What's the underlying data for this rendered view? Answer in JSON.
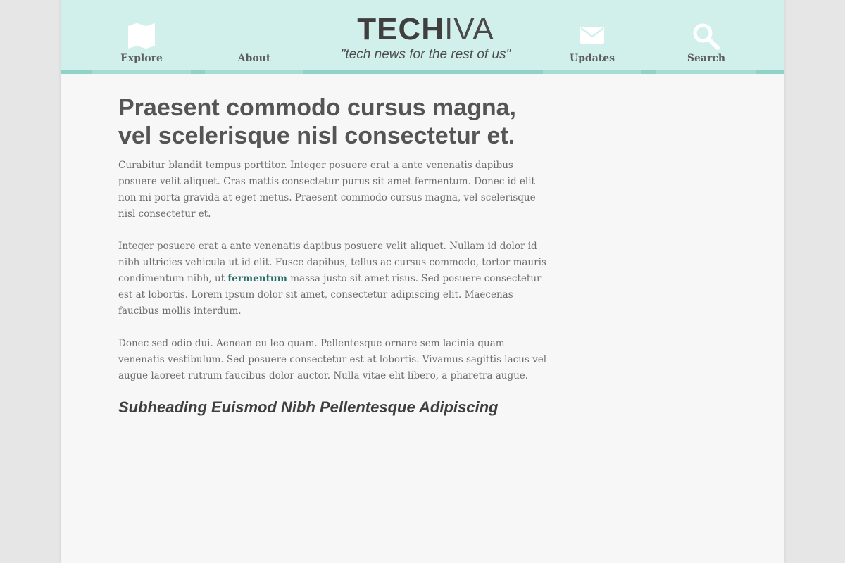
{
  "logo": {
    "tech": "TECH",
    "iva": "IVA",
    "tagline": "\"tech news for the rest of us\""
  },
  "nav": {
    "explore": "Explore",
    "about": "About",
    "updates": "Updates",
    "search": "Search"
  },
  "article": {
    "title": "Praesent commodo cursus magna, vel scelerisque nisl consectetur et.",
    "p1": "Curabitur blandit tempus porttitor. Integer posuere erat a ante venenatis dapibus posuere velit aliquet. Cras mattis consectetur purus sit amet fermentum. Donec id elit non mi porta gravida at eget metus. Praesent commodo cursus magna, vel scelerisque nisl consectetur et.",
    "p2_before": "Integer posuere erat a ante venenatis dapibus posuere velit aliquet. Nullam id dolor id nibh ultricies vehicula ut id elit. Fusce dapibus, tellus ac cursus commodo, tortor mauris condimentum nibh, ut ",
    "p2_link": "fermentum",
    "p2_after": " massa justo sit amet risus. Sed posuere consectetur est at lobortis. Lorem ipsum dolor sit amet, consectetur adipiscing elit. Maecenas faucibus mollis interdum.",
    "p3": "Donec sed odio dui. Aenean eu leo quam. Pellentesque ornare sem lacinia quam venenatis vestibulum. Sed posuere consectetur est at lobortis. Vivamus sagittis lacus vel augue laoreet rutrum faucibus dolor auctor. Nulla vitae elit libero, a pharetra augue.",
    "subheading": "Subheading Euismod Nibh Pellentesque Adipiscing"
  },
  "colors": {
    "header_bg": "#d1f0ec",
    "header_bar": "#a5dcd4",
    "header_bar_active": "#8fd2c8",
    "link": "#2a6f6a",
    "page_bg": "#f7f7f7",
    "outer_bg": "#e6e6e6"
  },
  "icons": {
    "explore": "map-icon",
    "updates": "envelope-icon",
    "search": "magnifier-icon"
  }
}
